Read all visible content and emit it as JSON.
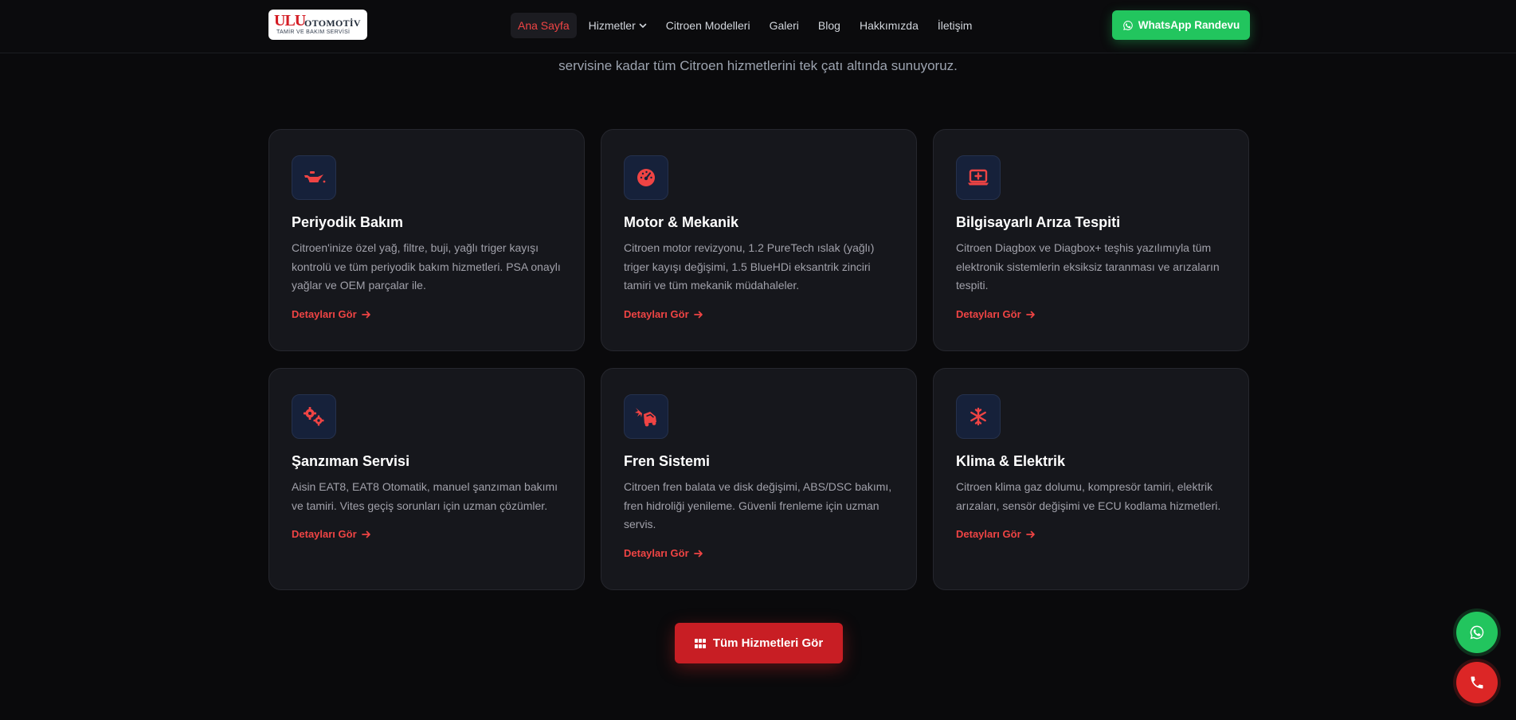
{
  "header": {
    "logo": {
      "brand": "ULU",
      "brand_rest": "OTOMOTİV",
      "tagline": "TAMİR VE BAKIM SERVİSİ"
    },
    "nav": [
      {
        "label": "Ana Sayfa",
        "active": true
      },
      {
        "label": "Hizmetler",
        "has_dropdown": true
      },
      {
        "label": "Citroen Modelleri"
      },
      {
        "label": "Galeri"
      },
      {
        "label": "Blog"
      },
      {
        "label": "Hakkımızda"
      },
      {
        "label": "İletişim"
      }
    ],
    "whatsapp_button": "WhatsApp Randevu"
  },
  "intro": {
    "text": "servisine kadar tüm Citroen hizmetlerini tek çatı altında sunuyoruz."
  },
  "services": [
    {
      "icon": "oil-can-icon",
      "title": "Periyodik Bakım",
      "description": "Citroen'inize özel yağ, filtre, buji, yağlı triger kayışı kontrolü ve tüm periyodik bakım hizmetleri. PSA onaylı yağlar ve OEM parçalar ile.",
      "link": "Detayları Gör"
    },
    {
      "icon": "gauge-icon",
      "title": "Motor & Mekanik",
      "description": "Citroen motor revizyonu, 1.2 PureTech ıslak (yağlı) triger kayışı değişimi, 1.5 BlueHDi eksantrik zinciri tamiri ve tüm mekanik müdahaleler.",
      "link": "Detayları Gör"
    },
    {
      "icon": "laptop-medical-icon",
      "title": "Bilgisayarlı Arıza Tespiti",
      "description": "Citroen Diagbox ve Diagbox+ teşhis yazılımıyla tüm elektronik sistemlerin eksiksiz taranması ve arızaların tespiti.",
      "link": "Detayları Gör"
    },
    {
      "icon": "gears-icon",
      "title": "Şanzıman Servisi",
      "description": "Aisin EAT8, EAT8 Otomatik, manuel şanzıman bakımı ve tamiri. Vites geçiş sorunları için uzman çözümler.",
      "link": "Detayları Gör"
    },
    {
      "icon": "car-burst-icon",
      "title": "Fren Sistemi",
      "description": "Citroen fren balata ve disk değişimi, ABS/DSC bakımı, fren hidroliği yenileme. Güvenli frenleme için uzman servis.",
      "link": "Detayları Gör"
    },
    {
      "icon": "snowflake-icon",
      "title": "Klima & Elektrik",
      "description": "Citroen klima gaz dolumu, kompresör tamiri, elektrik arızaları, sensör değişimi ve ECU kodlama hizmetleri.",
      "link": "Detayları Gör"
    }
  ],
  "cta": {
    "label": "Tüm Hizmetleri Gör",
    "icon": "grid-icon"
  },
  "floating": {
    "whatsapp_icon": "whatsapp-icon",
    "phone_icon": "phone-icon"
  },
  "colors": {
    "accent": "#ef4444",
    "whatsapp": "#22c55e",
    "background": "#0a0a0c",
    "card": "#16171c"
  }
}
